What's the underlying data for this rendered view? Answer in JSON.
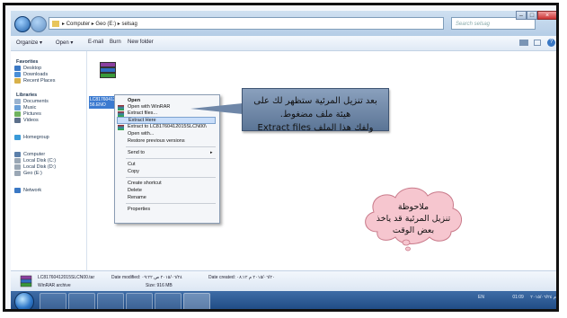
{
  "address": {
    "crumbs": [
      "Computer",
      "Geo (E:)",
      "selsag"
    ],
    "sep": "▸"
  },
  "search": {
    "placeholder": "Search selsag"
  },
  "toolbar": {
    "organize": "Organize ▾",
    "open": "Open ▾",
    "email": "E-mail",
    "burn": "Burn",
    "new_folder": "New folder"
  },
  "nav": {
    "favorites": "Favorites",
    "desktop": "Desktop",
    "downloads": "Downloads",
    "recent": "Recent Places",
    "libraries": "Libraries",
    "documents": "Documents",
    "music": "Music",
    "pictures": "Pictures",
    "videos": "Videos",
    "homegroup": "Homegroup",
    "computer": "Computer",
    "local_c": "Local Disk (C:)",
    "local_d": "Local Disk (D:)",
    "geo_e": "Geo (E:)",
    "network": "Network"
  },
  "file": {
    "name": "LC81760412015",
    "name2": "56.ENO"
  },
  "context_menu": {
    "open": "Open",
    "open_winrar": "Open with WinRAR",
    "extract_files": "Extract files...",
    "extract_here": "Extract Here",
    "extract_to": "Extract to LC81760412015SLCN00\\",
    "open_with": "Open with...",
    "restore": "Restore previous versions",
    "send_to": "Send to",
    "cut": "Cut",
    "copy": "Copy",
    "shortcut": "Create shortcut",
    "delete": "Delete",
    "rename": "Rename",
    "properties": "Properties"
  },
  "annotation": {
    "line1": "بعد تنزيل المرئية ستظهر لك على هيئة ملف مضغوط.",
    "line2": "ولفك هذا الملف Extract files"
  },
  "cloud_note": {
    "line1": "ملاحوظة",
    "line2": "تنزيل المرئية قد ياخذ",
    "line3": "بعض الوقت"
  },
  "details": {
    "filename": "LC81760412015SLCN00.tar",
    "modified": "Date modified: ٢٠١٥/٠٦/٢٤ ص ٠٩:٢٢",
    "created": "Date created: ٢٠١٥/٠٦/٢٠ م ٠٨:١٢",
    "type": "WinRAR archive",
    "size": "Size: 916 MB"
  },
  "tray": {
    "lang": "EN",
    "time": "01:09 م",
    "date": "٢٠١٥/٠٦/٢٤"
  },
  "colors": {
    "note_box": "#6f87a8",
    "cloud": "#f6c6cf",
    "highlight": "#c9defa"
  }
}
